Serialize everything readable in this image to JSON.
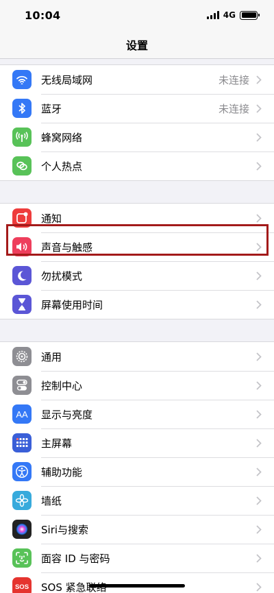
{
  "status": {
    "time": "10:04",
    "network": "4G"
  },
  "nav": {
    "title": "设置"
  },
  "groups": [
    {
      "items": [
        {
          "label": "无线局域网",
          "value": "未连接",
          "icon": "wifi-icon",
          "color": "#3478f6"
        },
        {
          "label": "蓝牙",
          "value": "未连接",
          "icon": "bluetooth-icon",
          "color": "#3478f6"
        },
        {
          "label": "蜂窝网络",
          "value": "",
          "icon": "antenna-icon",
          "color": "#58c258"
        },
        {
          "label": "个人热点",
          "value": "",
          "icon": "link-icon",
          "color": "#58c258"
        }
      ]
    },
    {
      "items": [
        {
          "label": "通知",
          "icon": "notification-icon",
          "color": "#ee3c3c"
        },
        {
          "label": "声音与触感",
          "icon": "speaker-icon",
          "color": "#ee3e5c"
        },
        {
          "label": "勿扰模式",
          "icon": "moon-icon",
          "color": "#5b56d6"
        },
        {
          "label": "屏幕使用时间",
          "icon": "hourglass-icon",
          "color": "#5b56d6"
        }
      ]
    },
    {
      "items": [
        {
          "label": "通用",
          "icon": "gear-icon",
          "color": "#8e8e93"
        },
        {
          "label": "控制中心",
          "icon": "toggles-icon",
          "color": "#8e8e93"
        },
        {
          "label": "显示与亮度",
          "icon": "text-size-icon",
          "color": "#3478f6",
          "glyph": "AA"
        },
        {
          "label": "主屏幕",
          "icon": "grid-icon",
          "color": "#3a5fd8"
        },
        {
          "label": "辅助功能",
          "icon": "accessibility-icon",
          "color": "#3478f6"
        },
        {
          "label": "墙纸",
          "icon": "flower-icon",
          "color": "#37aadc"
        },
        {
          "label": "Siri与搜索",
          "icon": "siri-icon",
          "color": "#222"
        },
        {
          "label": "面容 ID 与密码",
          "icon": "face-id-icon",
          "color": "#58c258"
        },
        {
          "label": "SOS 紧急联络",
          "icon": "sos-icon",
          "color": "#e5342f",
          "glyph": "SOS"
        }
      ]
    }
  ]
}
